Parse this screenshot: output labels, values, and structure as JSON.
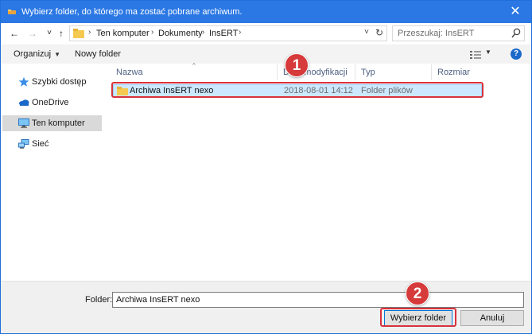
{
  "window": {
    "title": "Wybierz folder, do którego ma zostać pobrane archiwum.",
    "close_symbol": "✕",
    "accent_color": "#2b78e4"
  },
  "navigation": {
    "back_symbol": "←",
    "forward_symbol": "→",
    "recent_symbol": "˅",
    "up_symbol": "↑"
  },
  "address": {
    "crumbs": [
      "Ten komputer",
      "Dokumenty",
      "InsERT"
    ],
    "separator": "›",
    "dropdown_symbol": "˅",
    "refresh_symbol": "↻"
  },
  "search": {
    "placeholder": "Przeszukaj: InsERT"
  },
  "toolbar": {
    "organize_label": "Organizuj",
    "new_folder_label": "Nowy folder",
    "caret": "▼",
    "help_symbol": "?"
  },
  "sidebar": {
    "items": [
      {
        "label": "Szybki dostęp",
        "icon": "star-icon"
      },
      {
        "label": "OneDrive",
        "icon": "cloud-icon"
      },
      {
        "label": "Ten komputer",
        "icon": "computer-icon",
        "selected": true
      },
      {
        "label": "Sieć",
        "icon": "network-icon"
      }
    ]
  },
  "filelist": {
    "columns": [
      "Nazwa",
      "Data modyfikacji",
      "Typ",
      "Rozmiar"
    ],
    "rows": [
      {
        "name": "Archiwa InsERT nexo",
        "date": "2018-08-01 14:12",
        "type": "Folder plików",
        "size": "",
        "selected": true
      }
    ]
  },
  "footer": {
    "folder_label": "Folder:",
    "folder_value": "Archiwa InsERT nexo",
    "select_button": "Wybierz folder",
    "cancel_button": "Anuluj"
  },
  "annotations": {
    "badge_1": "1",
    "badge_2": "2",
    "highlight_color": "#d8323c"
  }
}
